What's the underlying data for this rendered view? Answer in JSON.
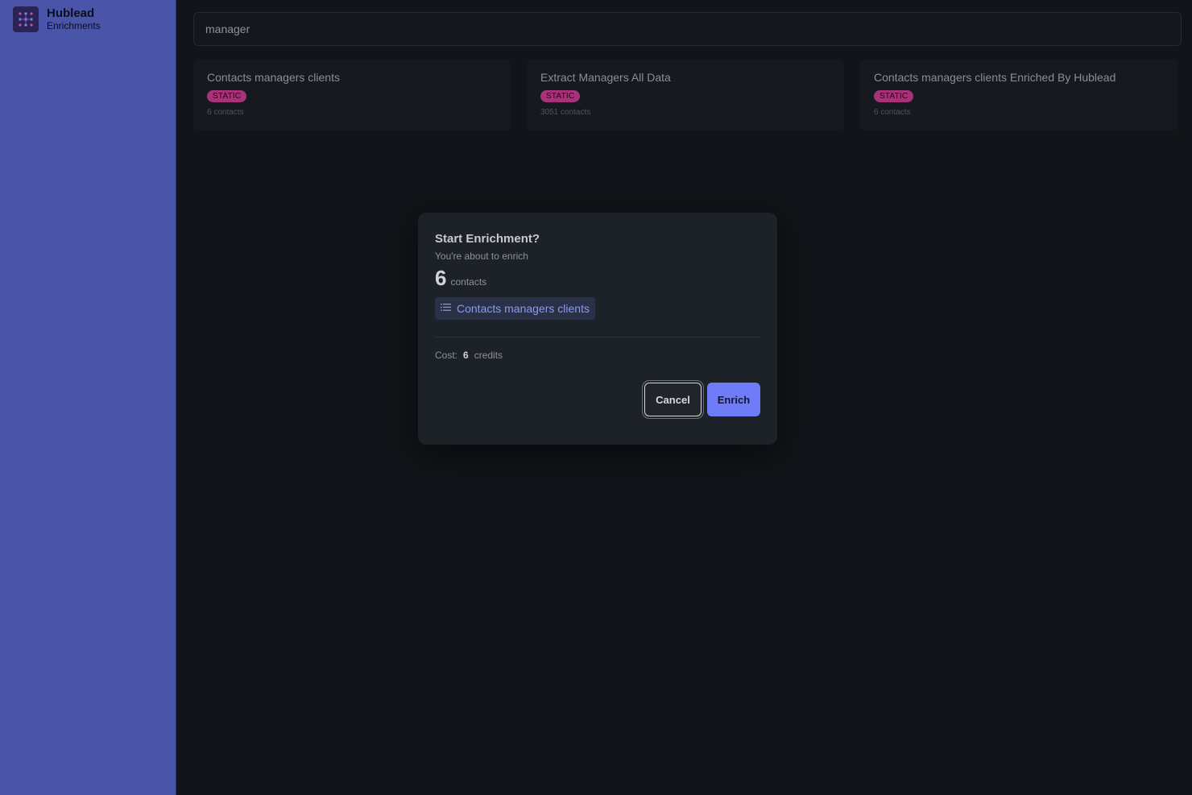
{
  "app": {
    "name": "Hublead",
    "section": "Enrichments",
    "logo_icon": "grid-nodes-icon"
  },
  "search": {
    "value": "manager"
  },
  "lists": [
    {
      "title": "Contacts managers clients",
      "type": "STATIC",
      "count": "6 contacts"
    },
    {
      "title": "Extract Managers All Data",
      "type": "STATIC",
      "count": "3051 contacts"
    },
    {
      "title": "Contacts managers clients Enriched By Hublead",
      "type": "STATIC",
      "count": "6 contacts"
    }
  ],
  "modal": {
    "title": "Start Enrichment?",
    "subtitle": "You're about to enrich",
    "count": "6",
    "count_unit": "contacts",
    "list_icon": "list-icon",
    "list_name": "Contacts managers clients",
    "cost_label": "Cost:",
    "cost_value": "6",
    "cost_unit": "credits",
    "cancel_label": "Cancel",
    "enrich_label": "Enrich"
  },
  "colors": {
    "sidebar": "#4a54a8",
    "background": "#111418",
    "badge": "#a8327a",
    "accent": "#6f7cf7"
  }
}
